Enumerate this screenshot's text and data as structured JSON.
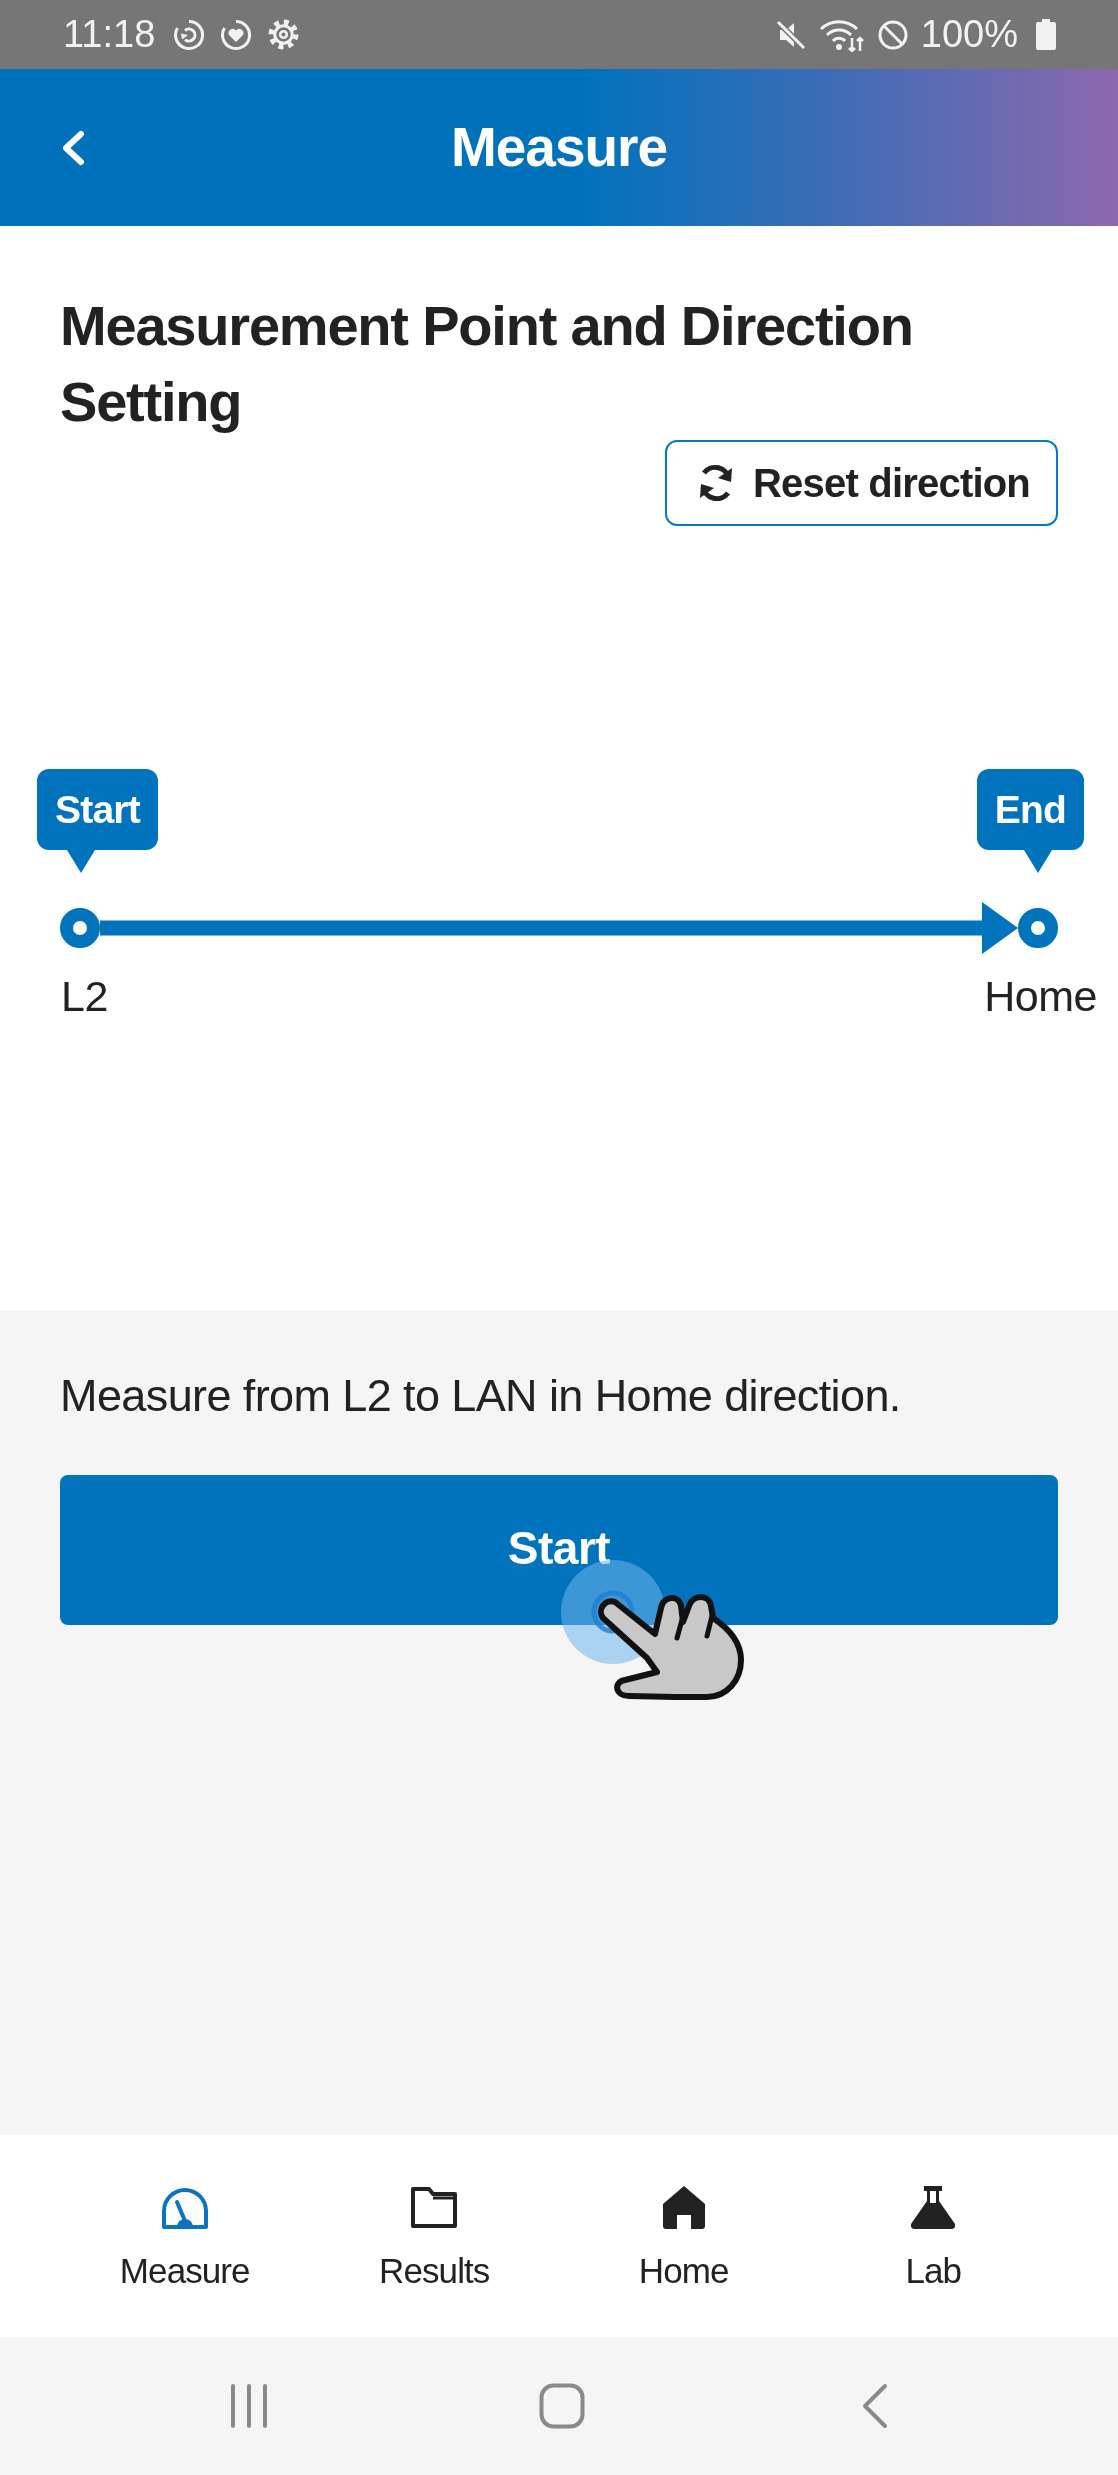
{
  "status_bar": {
    "time": "11:18",
    "battery": "100%"
  },
  "header": {
    "title": "Measure"
  },
  "setting": {
    "title": "Measurement Point and Direction Setting",
    "reset_button": "Reset direction"
  },
  "direction": {
    "start": {
      "tag": "Start",
      "point": "L2"
    },
    "end": {
      "tag": "End",
      "point": "Home"
    }
  },
  "panel": {
    "message": "Measure from L2 to LAN in Home direction.",
    "start_button": "Start"
  },
  "bottom_nav": [
    {
      "label": "Measure",
      "selected": true
    },
    {
      "label": "Results",
      "selected": false
    },
    {
      "label": "Home",
      "selected": false
    },
    {
      "label": "Lab",
      "selected": false
    }
  ]
}
